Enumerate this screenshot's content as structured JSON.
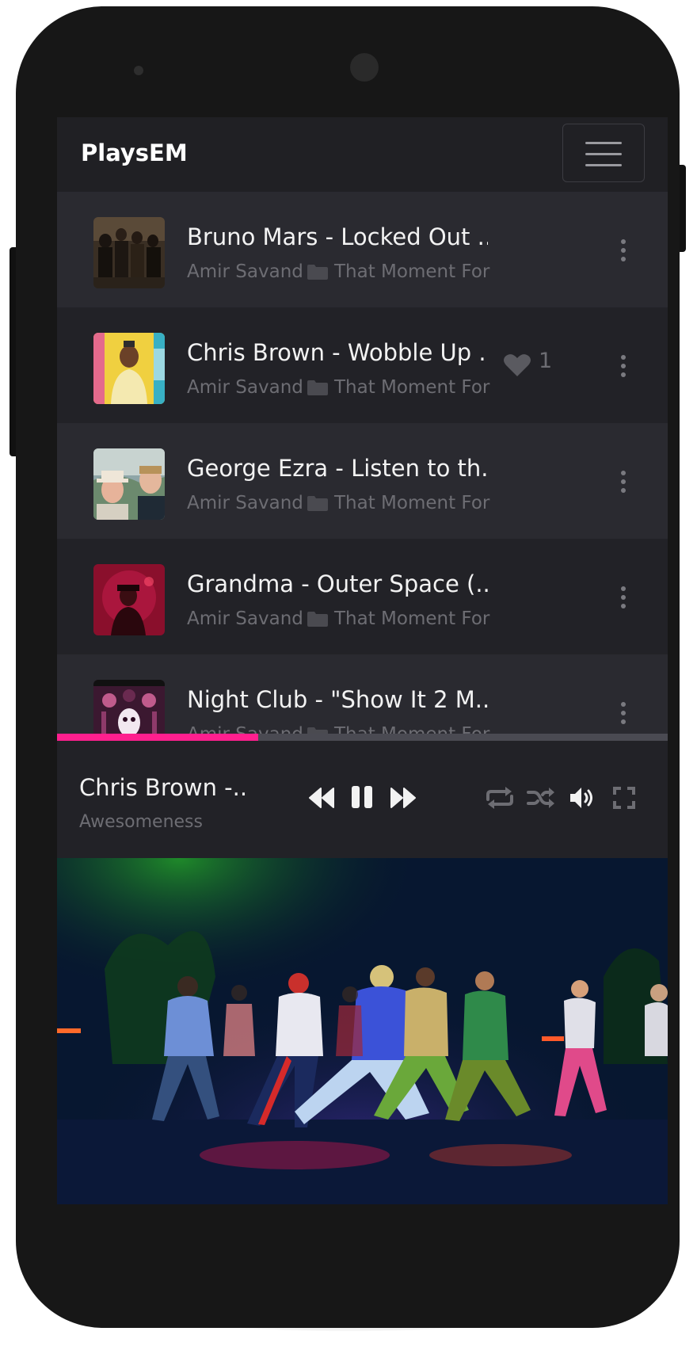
{
  "app": {
    "brand": "PlaysEM"
  },
  "playlist": {
    "tracks": [
      {
        "title": "Bruno Mars - Locked Out ...",
        "artist": "Amir Savand",
        "album": "That Moment For",
        "likes": ""
      },
      {
        "title": "Chris Brown - Wobble Up ...",
        "artist": "Amir Savand",
        "album": "That Moment For",
        "likes": "1"
      },
      {
        "title": "George Ezra - Listen to th...",
        "artist": "Amir Savand",
        "album": "That Moment For",
        "likes": ""
      },
      {
        "title": "Grandma - Outer Space (...",
        "artist": "Amir Savand",
        "album": "That Moment For",
        "likes": ""
      },
      {
        "title": "Night Club - \"Show It 2 M...",
        "artist": "Amir Savand",
        "album": "That Moment For",
        "likes": ""
      }
    ]
  },
  "player": {
    "title": "Chris Brown -...",
    "subtitle": "Awesomeness",
    "progress_fraction": 0.33,
    "accent_color": "#ff1f8e"
  },
  "icons": {
    "menu": "hamburger-icon",
    "folder": "folder-icon",
    "like": "heart-icon",
    "more": "more-vertical-icon",
    "rewind": "rewind-icon",
    "pause": "pause-icon",
    "forward": "fast-forward-icon",
    "repeat": "repeat-icon",
    "shuffle": "shuffle-icon",
    "volume": "volume-icon",
    "fullscreen": "fullscreen-icon"
  }
}
